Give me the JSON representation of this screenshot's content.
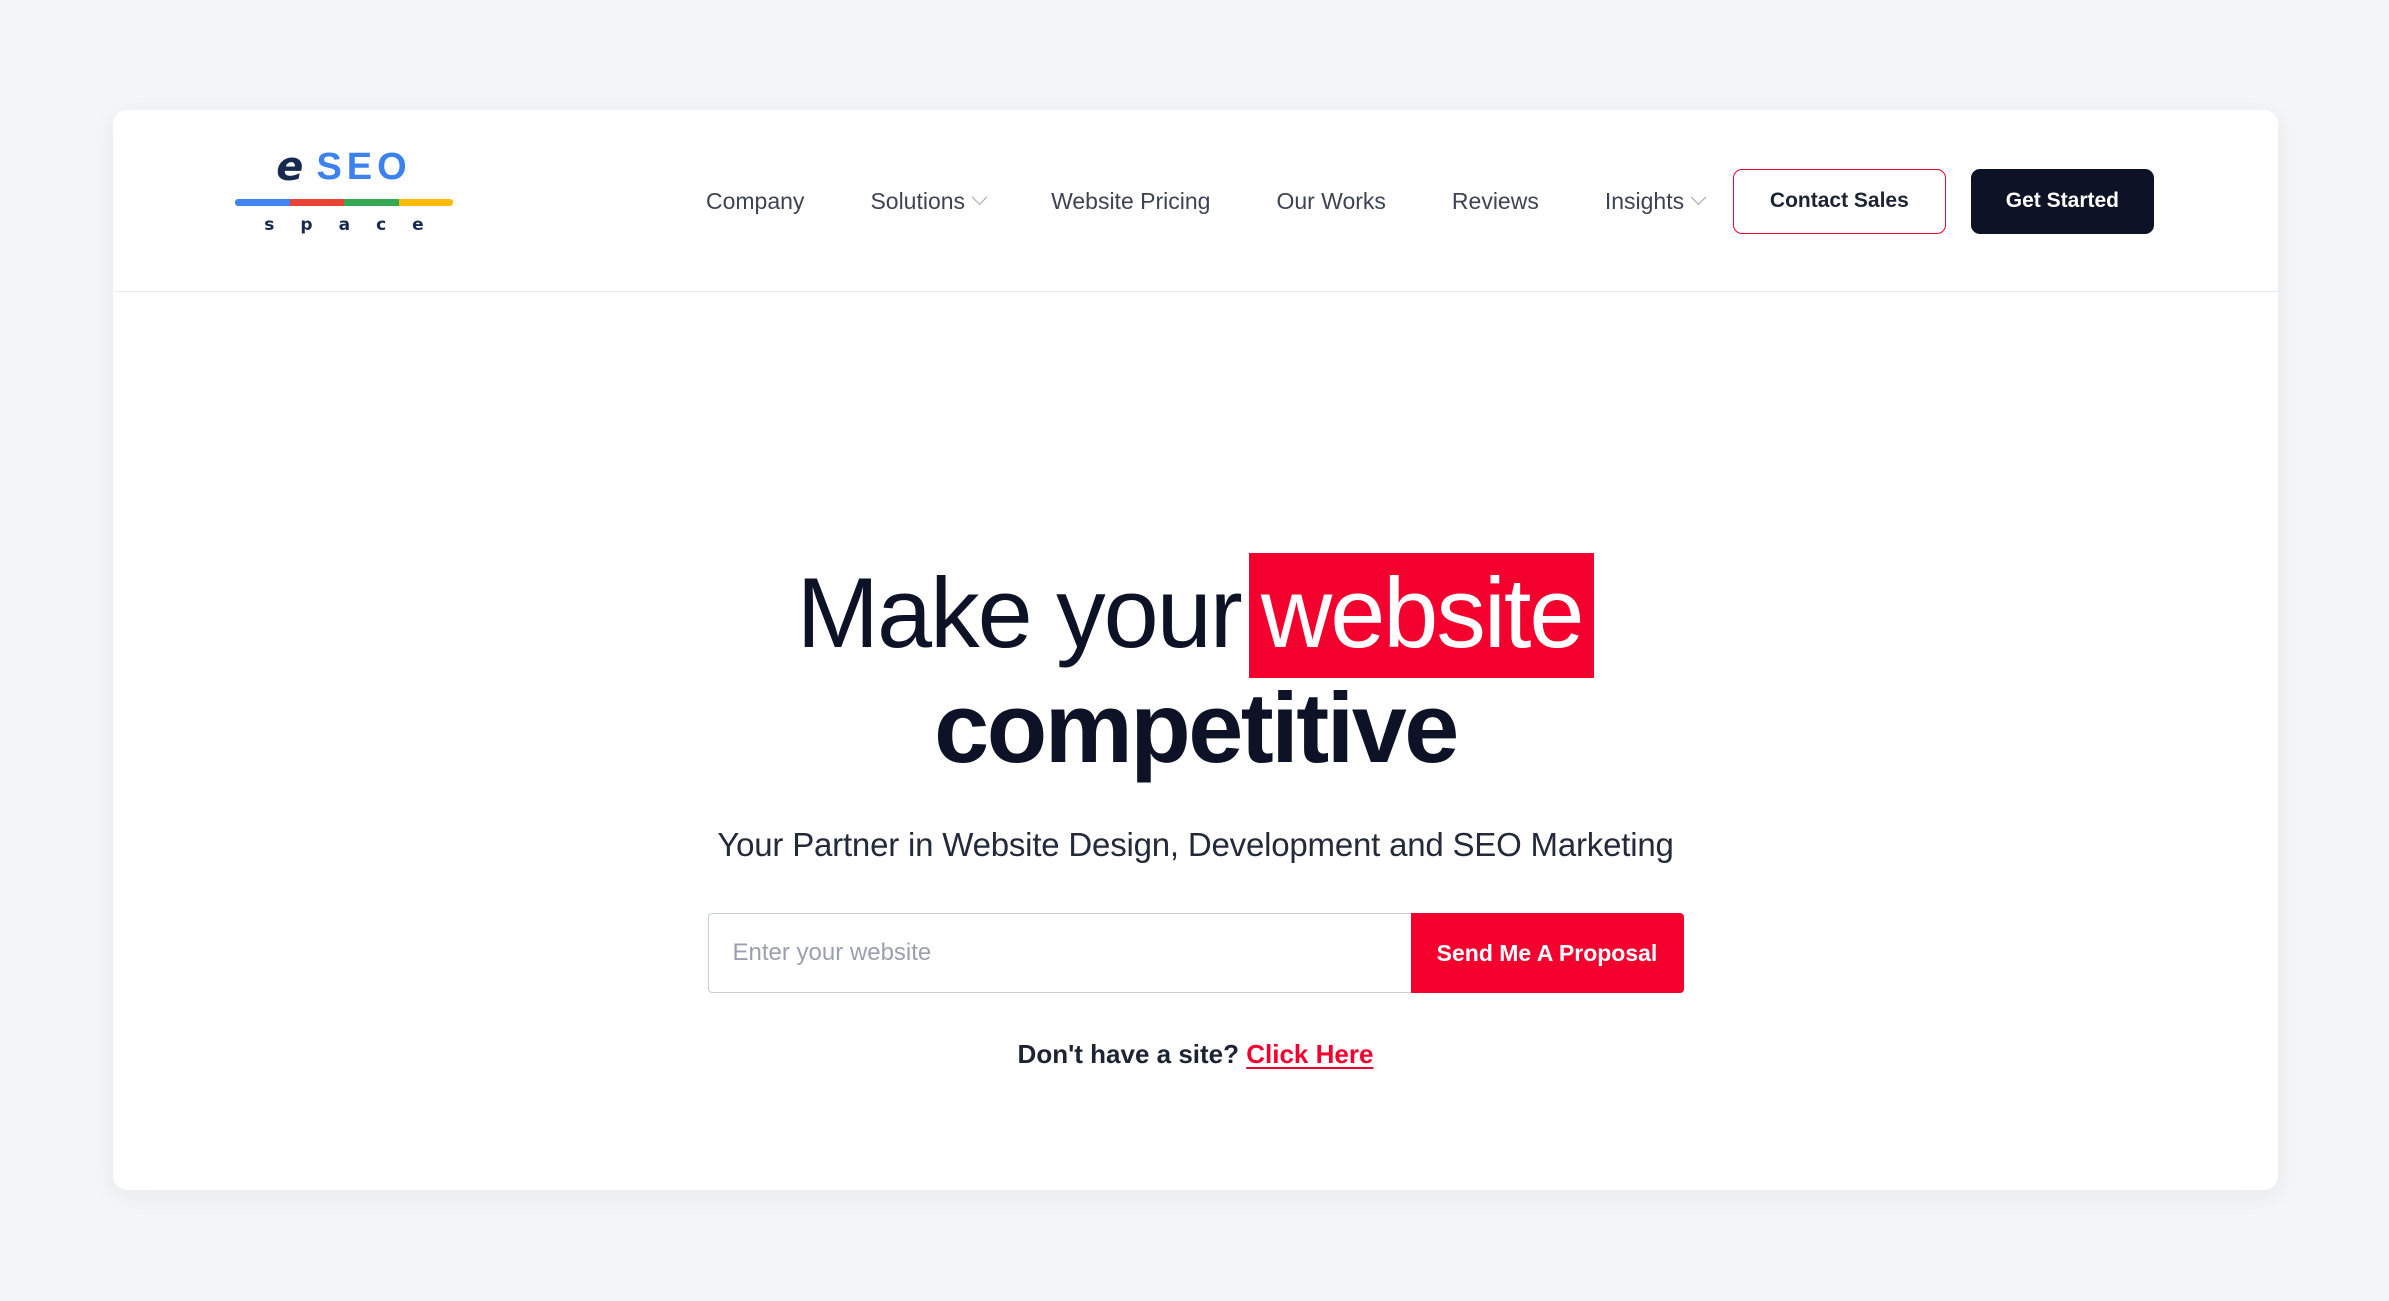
{
  "colors": {
    "page_background": "#f4f5f6",
    "card_background": "#ffffff",
    "accent_red": "#f4002f",
    "dark_navy": "#0d1226",
    "logo_blue": "#3b82f0",
    "bar_blue": "#4285f4",
    "bar_red": "#ea4335",
    "bar_green": "#34a853",
    "bar_yellow": "#fbbc05"
  },
  "header": {
    "logo": {
      "e": "e",
      "seo": "SEO",
      "word_letters": [
        "s",
        "p",
        "a",
        "c",
        "e"
      ]
    },
    "nav": [
      {
        "label": "Company",
        "has_dropdown": false
      },
      {
        "label": "Solutions",
        "has_dropdown": true
      },
      {
        "label": "Website Pricing",
        "has_dropdown": false
      },
      {
        "label": "Our Works",
        "has_dropdown": false
      },
      {
        "label": "Reviews",
        "has_dropdown": false
      },
      {
        "label": "Insights",
        "has_dropdown": true
      }
    ],
    "contact_sales_label": "Contact Sales",
    "get_started_label": "Get Started"
  },
  "hero": {
    "headline_line1_plain": "Make your",
    "headline_line1_highlight": "website",
    "headline_line2": "competitive",
    "subtitle": "Your Partner in Website Design, Development and SEO Marketing",
    "form": {
      "input_placeholder": "Enter your website",
      "input_value": "",
      "submit_label": "Send Me A Proposal"
    },
    "no_site_text": "Don't have a site?",
    "no_site_link": "Click Here"
  }
}
